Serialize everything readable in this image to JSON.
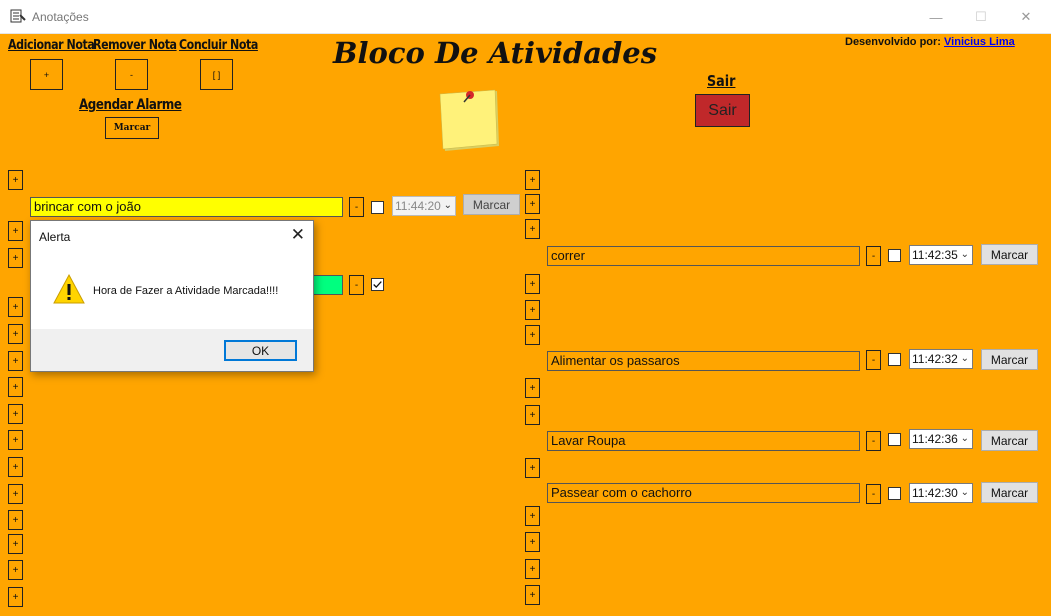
{
  "window": {
    "title": "Anotações",
    "minimize": "—",
    "maximize": "☐",
    "close": "✕"
  },
  "toolbar": {
    "add_label": "Adicionar Nota",
    "add_button": "+",
    "remove_label": "Remover Nota",
    "remove_button": "-",
    "complete_label": "Concluir Nota",
    "complete_button": "[ ]",
    "alarm_label": "Agendar Alarme",
    "alarm_button": "Marcar"
  },
  "header": {
    "title": "Bloco De Atividades",
    "developer_prefix": "Desenvolvido por:",
    "developer_name": "Vinicius Lima",
    "exit_label": "Sair",
    "exit_button": "Sair"
  },
  "left_notes": [
    {
      "text": "brincar com o joão",
      "time": "11:44:20",
      "button": "Marcar",
      "color": "#ffff00"
    }
  ],
  "right_notes": [
    {
      "text": "correr",
      "time": "11:42:35",
      "button": "Marcar"
    },
    {
      "text": "Alimentar os passaros",
      "time": "11:42:32",
      "button": "Marcar"
    },
    {
      "text": "Lavar Roupa",
      "time": "11:42:36",
      "button": "Marcar"
    },
    {
      "text": "Passear com o cachorro",
      "time": "11:42:30",
      "button": "Marcar"
    }
  ],
  "dialog": {
    "title": "Alerta",
    "message": "Hora de Fazer a Atividade Marcada!!!!",
    "ok": "OK",
    "icon": "warning-icon"
  },
  "plus": "+",
  "minus": "-",
  "colors": {
    "background": "#ffa500",
    "exit_button": "#c0282a",
    "completed_note": "#00ff7f"
  }
}
